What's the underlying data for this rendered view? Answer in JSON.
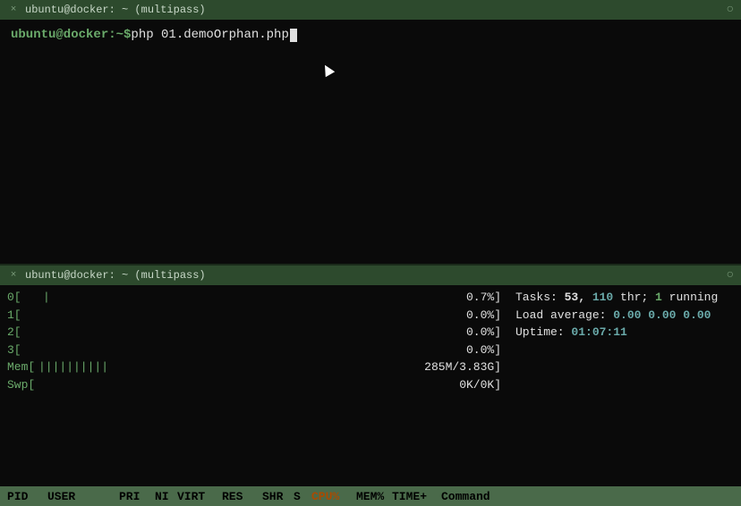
{
  "top_terminal": {
    "title": "ubuntu@docker: ~ (multipass)",
    "close_symbol": "○",
    "minimize_symbol": "×",
    "prompt_user": "ubuntu@docker:~$",
    "command": " php 01.demoOrphan.php"
  },
  "bottom_terminal": {
    "title": "ubuntu@docker: ~ (multipass)",
    "close_symbol": "○",
    "minimize_symbol": "×"
  },
  "htop": {
    "cpu_rows": [
      {
        "label": "0[",
        "bar": "|",
        "percent": "0.7%]"
      },
      {
        "label": "1[",
        "bar": "",
        "percent": "0.0%]"
      },
      {
        "label": "2[",
        "bar": "",
        "percent": "0.0%]"
      },
      {
        "label": "3[",
        "bar": "",
        "percent": "0.0%]"
      }
    ],
    "mem_bar": "||||||||||",
    "mem_value": "285M/3.83G]",
    "mem_label": "Mem[",
    "swp_label": "Swp[",
    "swp_value": "0K/0K]",
    "tasks_label": "Tasks:",
    "tasks_count": "53,",
    "tasks_thr": "110",
    "tasks_thr_label": "thr;",
    "tasks_running": "1",
    "tasks_running_label": "running",
    "load_label": "Load average:",
    "load_1": "0.00",
    "load_5": "0.00",
    "load_15": "0.00",
    "uptime_label": "Uptime:",
    "uptime_value": "01:07:11",
    "header": {
      "pid": "PID",
      "user": "USER",
      "pri": "PRI",
      "ni": "NI",
      "virt": "VIRT",
      "res": "RES",
      "shr": "SHR",
      "s": "S",
      "cpu": "CPU%",
      "mem": "MEM%",
      "time": "TIME+",
      "cmd": "Command"
    }
  }
}
